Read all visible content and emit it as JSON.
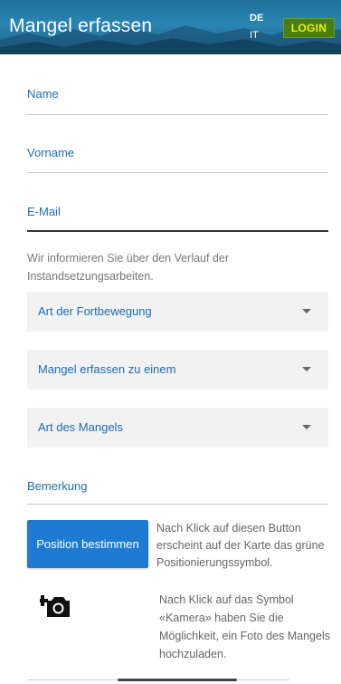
{
  "header": {
    "title": "Mangel erfassen",
    "languages": [
      "DE",
      "IT"
    ],
    "login_label": "LOGIN",
    "colors": {
      "bar": "#2a85b3",
      "login_bg": "#4b7e12",
      "login_text": "#e8f500"
    }
  },
  "form": {
    "name_label": "Name",
    "vorname_label": "Vorname",
    "email_label": "E-Mail",
    "info_text": "Wir informieren Sie über den Verlauf der Instandsetzungsarbeiten.",
    "selects": [
      {
        "label": "Art der Fortbewegung"
      },
      {
        "label": "Mangel erfassen zu einem"
      },
      {
        "label": "Art des Mangels"
      }
    ],
    "bemerkung_label": "Bemerkung",
    "position_button_label": "Position bestimmen",
    "position_desc": "Nach Klick auf diesen Button erscheint auf der Karte das grüne Positionierungssymbol.",
    "camera_icon": "add-photo-icon",
    "camera_desc": "Nach Klick auf das Symbol «Kamera» haben Sie die Möglichkeit, ein Foto des Mangels hochzuladen.",
    "colors": {
      "label_blue": "#1e6cb0",
      "button_blue": "#1e7bd4"
    }
  }
}
